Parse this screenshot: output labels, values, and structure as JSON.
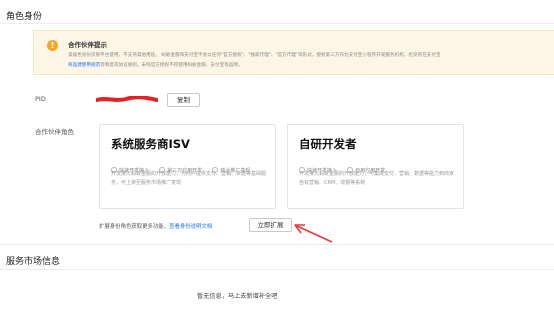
{
  "role_section": {
    "title": "角色身份"
  },
  "notice": {
    "icon": "info-icon",
    "title": "合作伙伴提示",
    "line1": "该角色身份仅限平台使用，不支持其他用途。 蚂蚁金服和支付宝不会以任何\"官方授权\"、\"独家代理\"、\"官方代理\"等形式，授权第三方作为支付宝小程序开发服务机构，也没有在支付宝",
    "line2_link": "商品建使用规范",
    "line2_text": "等制度或协议规则，未经官方授权不得使用蚂蚁金服、支付宝等品牌。",
    "colors": {
      "background": "#fdf6e6",
      "icon": "#f5a623"
    }
  },
  "pid": {
    "label": "PID",
    "copy_label": "复制"
  },
  "partner_role": {
    "label": "合作伙伴角色",
    "cards": [
      {
        "title": "系统服务商ISV",
        "options": [
          "快速开发接入",
          "第三方应用开发",
          "商业推广变现"
        ],
        "description": "开发接入蚂蚁金服的开放能力，为商户提供支付、营销、数据等基础服务，可上架至服务市场推广变现"
      },
      {
        "title": "自研开发者",
        "options": [
          "快速开发接入",
          "自用应用开发"
        ],
        "description": "开发接入蚂蚁金服的开放能力，可集成支付、营销、数据等能力到商家自有营销、CRM、收银等系统"
      }
    ]
  },
  "expand": {
    "note": "扩展身份角色获取更多功能，",
    "link": "查看身份说明文档",
    "button": "立即扩展",
    "arrow_color": "#e23a3a"
  },
  "market_section": {
    "title": "服务市场信息",
    "empty_text": "暂无信息，马上去新增补全吧"
  }
}
